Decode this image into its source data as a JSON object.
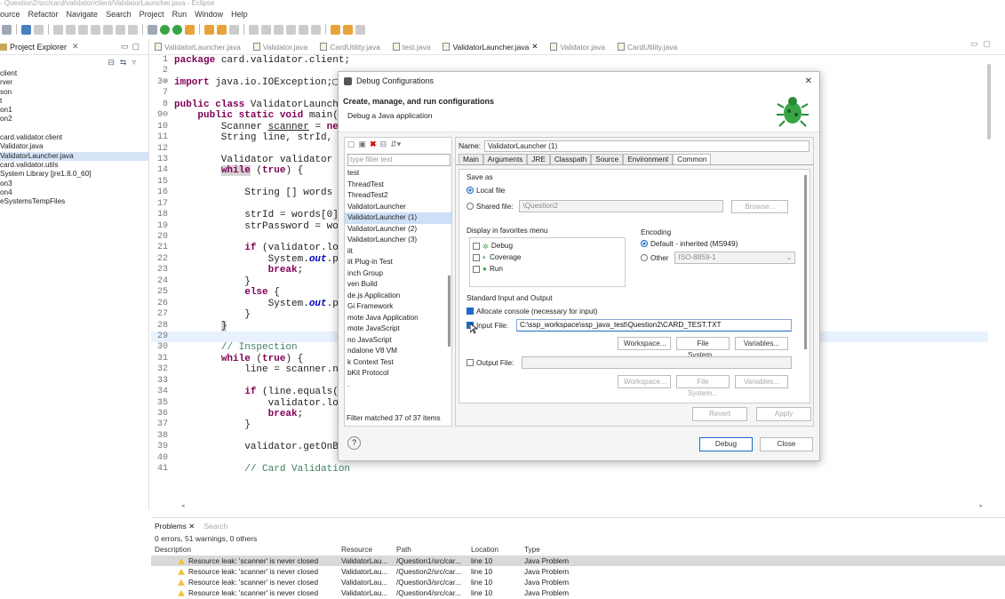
{
  "window": {
    "title": "- Question2/src/card/validator/client/ValidatorLauncher.java - Eclipse"
  },
  "menu": [
    "ource",
    "Refactor",
    "Navigate",
    "Search",
    "Project",
    "Run",
    "Window",
    "Help"
  ],
  "explorer": {
    "title": "Project Explorer",
    "items": [
      {
        "label": "client",
        "sel": false
      },
      {
        "label": "rver",
        "sel": false
      },
      {
        "label": "son",
        "sel": false
      },
      {
        "label": "t",
        "sel": false
      },
      {
        "label": "on1",
        "sel": false
      },
      {
        "label": "on2",
        "sel": false
      },
      {
        "label": "",
        "sel": false
      },
      {
        "label": " card.validator.client",
        "sel": false
      },
      {
        "label": "  Validator.java",
        "sel": false
      },
      {
        "label": "  ValidatorLauncher.java",
        "sel": true
      },
      {
        "label": " card.validator.utils",
        "sel": false
      },
      {
        "label": " System Library [jre1.8.0_60]",
        "sel": false
      },
      {
        "label": "on3",
        "sel": false
      },
      {
        "label": "on4",
        "sel": false
      },
      {
        "label": "eSystemsTempFiles",
        "sel": false
      }
    ]
  },
  "editor_tabs": [
    {
      "label": "ValidatorLauncher.java",
      "active": false
    },
    {
      "label": "Validator.java",
      "active": false
    },
    {
      "label": "CardUtility.java",
      "active": false
    },
    {
      "label": "test.java",
      "active": false
    },
    {
      "label": "ValidatorLauncher.java",
      "active": true
    },
    {
      "label": "Validator.java",
      "active": false
    },
    {
      "label": "CardUtility.java",
      "active": false
    }
  ],
  "code": [
    {
      "n": "1",
      "html": "<span class=\"kw\">package</span> card.validator.client;"
    },
    {
      "n": "2",
      "html": ""
    },
    {
      "n": "3⊕",
      "html": "<span class=\"kw\">import</span> java.io.IOException;▢"
    },
    {
      "n": "7",
      "html": ""
    },
    {
      "n": "8",
      "html": "<span class=\"kw\">public class</span> ValidatorLaunche"
    },
    {
      "n": "9⊖",
      "html": "    <span class=\"kw\">public static void</span> main(S"
    },
    {
      "n": "10",
      "html": "        Scanner <u>scanner</u> = <span class=\"kw\">new</span>"
    },
    {
      "n": "11",
      "html": "        String line, strId, s"
    },
    {
      "n": "12",
      "html": ""
    },
    {
      "n": "13",
      "html": "        Validator validator ="
    },
    {
      "n": "14",
      "html": "        <span class=\"kw\" style=\"background:#d4d4d4\">while</span> (<span class=\"kw\">true</span>) {"
    },
    {
      "n": "15",
      "html": ""
    },
    {
      "n": "16",
      "html": "            String [] words ="
    },
    {
      "n": "17",
      "html": ""
    },
    {
      "n": "18",
      "html": "            strId = words[0]."
    },
    {
      "n": "19",
      "html": "            strPassword = wor"
    },
    {
      "n": "20",
      "html": ""
    },
    {
      "n": "21",
      "html": "            <span class=\"kw\">if</span> (validator.lo"
    },
    {
      "n": "22",
      "html": "                System.<span class=\"it\">out</span>.pr"
    },
    {
      "n": "23",
      "html": "                <span class=\"kw\">break</span>;"
    },
    {
      "n": "24",
      "html": "            }"
    },
    {
      "n": "25",
      "html": "            <span class=\"kw\">else</span> {"
    },
    {
      "n": "26",
      "html": "                System.<span class=\"it\">out</span>.pr"
    },
    {
      "n": "27",
      "html": "            }"
    },
    {
      "n": "28",
      "html": "        <span style=\"background:#d4d4d4\">}</span>"
    },
    {
      "n": "29",
      "html": "",
      "hl": true
    },
    {
      "n": "30",
      "html": "        <span class=\"cm\">// Inspection</span>"
    },
    {
      "n": "31",
      "html": "        <span class=\"kw\">while</span> (<span class=\"kw\">true</span>) {"
    },
    {
      "n": "32",
      "html": "            line = scanner.ne"
    },
    {
      "n": "33",
      "html": ""
    },
    {
      "n": "34",
      "html": "            <span class=\"kw\">if</span> (line.equals(\""
    },
    {
      "n": "35",
      "html": "                validator.lo"
    },
    {
      "n": "36",
      "html": "                <span class=\"kw\">break</span>;"
    },
    {
      "n": "37",
      "html": "            }"
    },
    {
      "n": "38",
      "html": ""
    },
    {
      "n": "39",
      "html": "            validator.getOnBus(line);"
    },
    {
      "n": "40",
      "html": ""
    },
    {
      "n": "41",
      "html": "            <span class=\"cm\">// Card Validation</span>"
    }
  ],
  "problems": {
    "tab": "Problems",
    "tab2": "Search",
    "summary": "0 errors, 51 warnings, 0 others",
    "columns": [
      "Description",
      "Resource",
      "Path",
      "Location",
      "Type"
    ],
    "rows": [
      [
        "Resource leak: 'scanner' is never closed",
        "ValidatorLau...",
        "/Question1/src/car...",
        "line 10",
        "Java Problem"
      ],
      [
        "Resource leak: 'scanner' is never closed",
        "ValidatorLau...",
        "/Question2/src/car...",
        "line 10",
        "Java Problem"
      ],
      [
        "Resource leak: 'scanner' is never closed",
        "ValidatorLau...",
        "/Question3/src/car...",
        "line 10",
        "Java Problem"
      ],
      [
        "Resource leak: 'scanner' is never closed",
        "ValidatorLau...",
        "/Question4/src/car...",
        "line 10",
        "Java Problem"
      ]
    ]
  },
  "dialog": {
    "title": "Debug Configurations",
    "header": "Create, manage, and run configurations",
    "subheader": "Debug a Java application",
    "filter_placeholder": "type filter text",
    "configs": [
      {
        "label": "test",
        "sel": false
      },
      {
        "label": "ThreadTest",
        "sel": false
      },
      {
        "label": "ThreadTest2",
        "sel": false
      },
      {
        "label": "ValidatorLauncher",
        "sel": false
      },
      {
        "label": "ValidatorLauncher (1)",
        "sel": true
      },
      {
        "label": "ValidatorLauncher (2)",
        "sel": false
      },
      {
        "label": "ValidatorLauncher (3)",
        "sel": false
      },
      {
        "label": "iit",
        "sel": false
      },
      {
        "label": "iit Plug-in Test",
        "sel": false
      },
      {
        "label": "inch Group",
        "sel": false
      },
      {
        "label": "ven Build",
        "sel": false
      },
      {
        "label": "de.js Application",
        "sel": false
      },
      {
        "label": "Gi Framework",
        "sel": false
      },
      {
        "label": "mote Java Application",
        "sel": false
      },
      {
        "label": "mote JavaScript",
        "sel": false
      },
      {
        "label": "no JavaScript",
        "sel": false
      },
      {
        "label": "ndalone V8 VM",
        "sel": false
      },
      {
        "label": "k Context Test",
        "sel": false
      },
      {
        "label": "bKit Protocol",
        "sel": false
      },
      {
        "label": ".",
        "sel": false
      }
    ],
    "filter_status": "Filter matched 37 of 37 items",
    "name_label": "Name:",
    "name_value": "ValidatorLauncher (1)",
    "tabs": [
      {
        "label": "Main",
        "active": false
      },
      {
        "label": "Arguments",
        "active": false
      },
      {
        "label": "JRE",
        "active": false
      },
      {
        "label": "Classpath",
        "active": false
      },
      {
        "label": "Source",
        "active": false
      },
      {
        "label": "Environment",
        "active": false
      },
      {
        "label": "Common",
        "active": true
      }
    ],
    "save_as": "Save as",
    "local_file": "Local file",
    "shared_file": "Shared file:",
    "shared_value": "\\Question2",
    "browse": "Browse...",
    "favorites_label": "Display in favorites menu",
    "favorites": [
      "Debug",
      "Coverage",
      "Run"
    ],
    "encoding_label": "Encoding",
    "encoding_default": "Default - inherited (MS949)",
    "encoding_other": "Other",
    "encoding_other_value": "ISO-8859-1",
    "stdio_label": "Standard Input and Output",
    "allocate_console": "Allocate console (necessary for input)",
    "input_file": "Input File:",
    "input_file_value": "C:\\ssp_workspace\\ssp_java_test\\Question2\\CARD_TEST.TXT",
    "workspace_btn": "Workspace...",
    "filesystem_btn": "File System...",
    "variables_btn": "Variables...",
    "output_file": "Output File:",
    "revert": "Revert",
    "apply": "Apply",
    "debug_btn": "Debug",
    "close_btn": "Close",
    "help": "?"
  }
}
